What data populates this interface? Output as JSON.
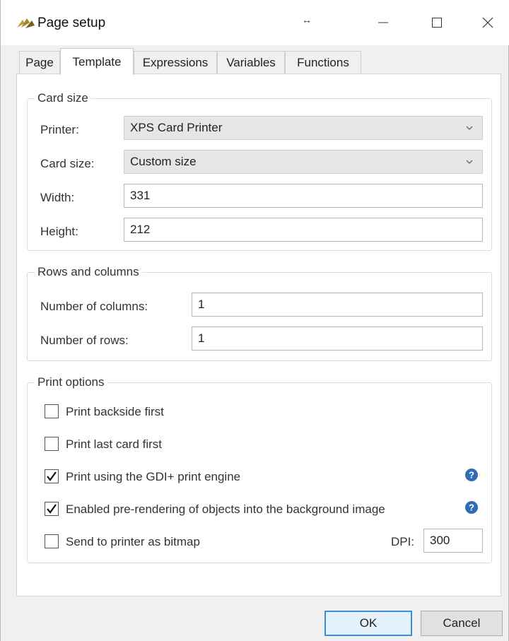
{
  "window": {
    "title": "Page setup",
    "resize_hint": "↔"
  },
  "tabs": [
    {
      "label": "Page"
    },
    {
      "label": "Template"
    },
    {
      "label": "Expressions"
    },
    {
      "label": "Variables"
    },
    {
      "label": "Functions"
    }
  ],
  "active_tab": "Template",
  "card_size": {
    "group_label": "Card size",
    "printer_label": "Printer:",
    "printer_value": "XPS Card Printer",
    "card_size_label": "Card size:",
    "card_size_value": "Custom size",
    "width_label": "Width:",
    "width_value": "331",
    "height_label": "Height:",
    "height_value": "212"
  },
  "rows_columns": {
    "group_label": "Rows and columns",
    "columns_label": "Number of columns:",
    "columns_value": "1",
    "rows_label": "Number of rows:",
    "rows_value": "1"
  },
  "print_options": {
    "group_label": "Print options",
    "options": [
      {
        "label": "Print backside first",
        "checked": false
      },
      {
        "label": "Print last card first",
        "checked": false
      },
      {
        "label": "Print using the GDI+ print engine",
        "checked": true
      },
      {
        "label": "Enabled pre-rendering of objects into the background image",
        "checked": true
      },
      {
        "label": "Send to printer as bitmap",
        "checked": false
      }
    ],
    "dpi_label": "DPI:",
    "dpi_value": "300"
  },
  "buttons": {
    "ok": "OK",
    "cancel": "Cancel"
  },
  "colors": {
    "help_icon": "#2f6db5",
    "default_button_border": "#3d8fd6"
  }
}
